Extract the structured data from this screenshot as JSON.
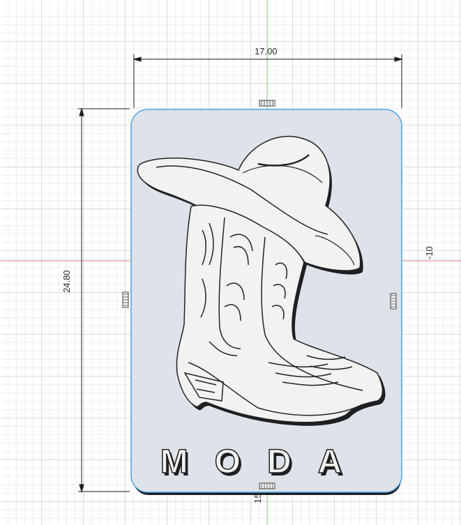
{
  "viewport": {
    "dimension_width": "17.00",
    "dimension_height": "24.80",
    "axis_label_right": "-10",
    "axis_label_bottom": "15"
  },
  "plate": {
    "text": "MODA"
  },
  "colors": {
    "plate_fill": "#dde3e8",
    "selection_edge": "#4aa3e6",
    "x_axis": "#e05050",
    "y_axis": "#6ccf6c",
    "relief": "#f2f2f0"
  }
}
